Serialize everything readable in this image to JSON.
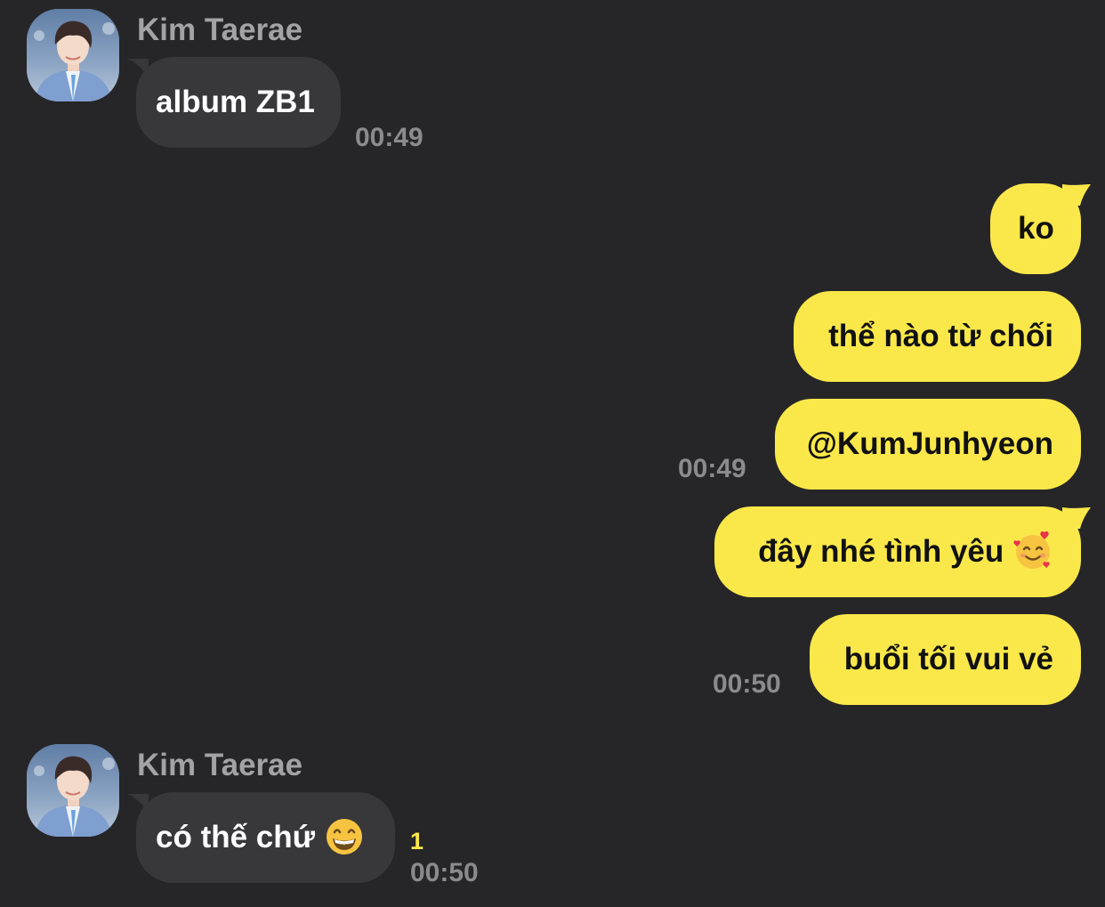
{
  "colors": {
    "background": "#262628",
    "incoming_bubble": "#38383b",
    "outgoing_bubble": "#fae84a",
    "timestamp": "#8b8b8e",
    "unread": "#fae84a"
  },
  "messages": [
    {
      "sender": "Kim Taerae",
      "avatar": "profile-photo",
      "text": "album ZB1",
      "time": "00:49"
    },
    {
      "outgoing": [
        {
          "text": "ko"
        },
        {
          "text": "thể nào từ chối"
        },
        {
          "text": "@KumJunhyeon",
          "time": "00:49"
        },
        {
          "text": "đây nhé tình yêu",
          "emoji": "smiling-face-with-hearts-icon"
        },
        {
          "text": "buổi tối vui vẻ",
          "time": "00:50"
        }
      ]
    },
    {
      "sender": "Kim Taerae",
      "avatar": "profile-photo",
      "text": "có thế chứ",
      "emoji": "grinning-face-icon",
      "unread": "1",
      "time": "00:50"
    }
  ]
}
